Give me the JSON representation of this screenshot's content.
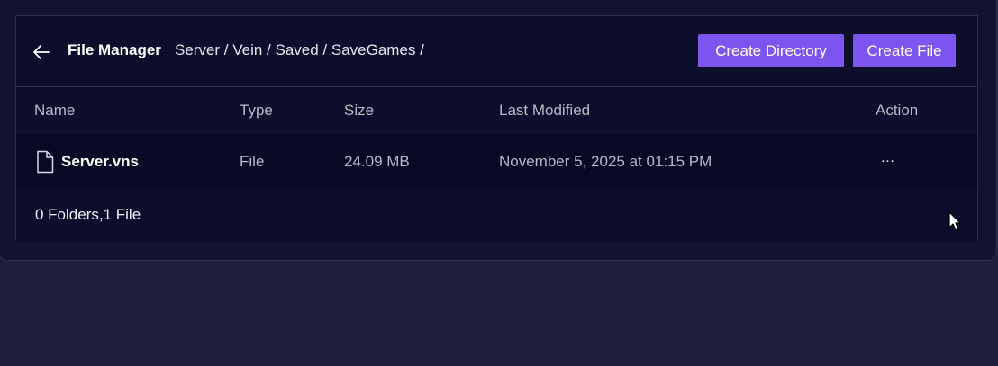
{
  "header": {
    "title": "File Manager",
    "breadcrumb": "Server / Vein / Saved / SaveGames /",
    "create_directory_label": "Create Directory",
    "create_file_label": "Create File",
    "back_icon": "arrow-left-icon"
  },
  "table": {
    "columns": [
      "Name",
      "Type",
      "Size",
      "Last Modified",
      "Action"
    ],
    "rows": [
      {
        "name": "Server.vns",
        "type": "File",
        "size": "24.09 MB",
        "last_modified": "November 5, 2025 at 01:15 PM",
        "action": "…",
        "icon": "file-icon"
      }
    ]
  },
  "footer": {
    "summary": "0 Folders,1 File"
  },
  "colors": {
    "accent": "#7c54ee",
    "background": "#1e1f3f",
    "panel": "#0d0e2b",
    "row": "#080a25"
  }
}
